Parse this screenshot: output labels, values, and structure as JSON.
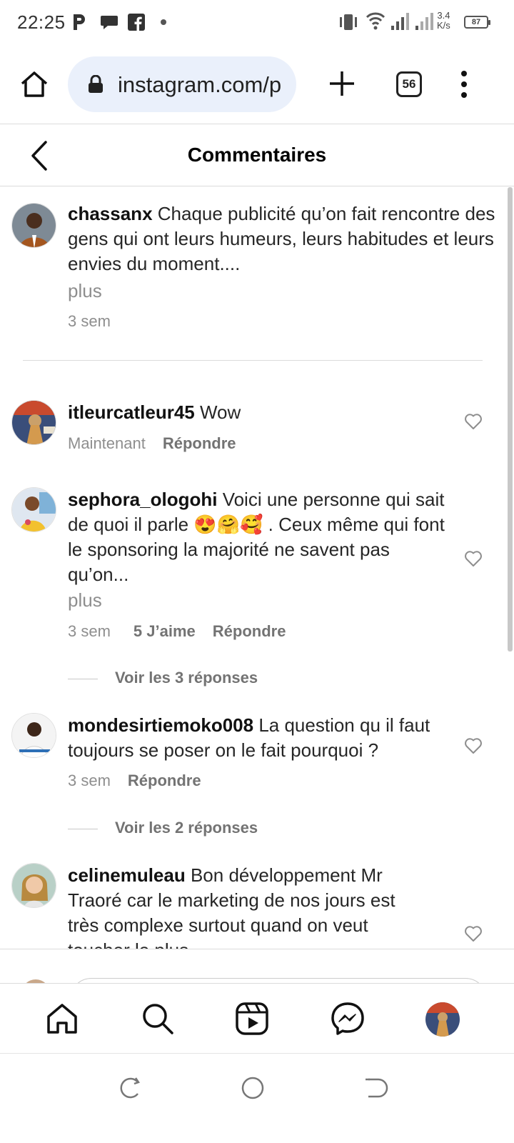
{
  "status_bar": {
    "time": "22:25",
    "notif_icons": [
      "p-icon",
      "chat-icon",
      "facebook-icon",
      "dot-icon"
    ],
    "speed_top": "3.4",
    "speed_bottom": "K/s",
    "battery": "87"
  },
  "browser": {
    "url": "instagram.com/p",
    "tab_count": "56"
  },
  "header": {
    "title": "Commentaires"
  },
  "comments": [
    {
      "user": "chassanx",
      "text": " Chaque publicité qu’on fait rencontre des gens qui ont leurs humeurs, leurs habitudes et leurs envies du moment....",
      "more": "plus",
      "time": "3 sem"
    },
    {
      "user": "itleurcatleur45",
      "text": " Wow",
      "time": "Maintenant",
      "reply": "Répondre"
    },
    {
      "user": "sephora_ologohi",
      "text": " Voici une personne qui sait de quoi il parle 😍🤗🥰 . Ceux même qui font le sponsoring la majorité ne savent pas qu’on...",
      "more": "plus",
      "time": "3 sem",
      "likes": "5 J’aime",
      "reply": "Répondre",
      "view_replies": "Voir les 3 réponses"
    },
    {
      "user": "mondesirtiemoko008",
      "text": " La question qu il faut toujours se poser on le fait pourquoi ?",
      "time": "3 sem",
      "reply": "Répondre",
      "view_replies": "Voir les 2 réponses"
    },
    {
      "user": "celinemuleau",
      "text": " Bon développement Mr Traoré car le marketing de nos jours est très complexe surtout quand on veut toucher le plus"
    }
  ],
  "colors": {
    "url_bg": "#eaf0fb",
    "secondary_text": "#8e8e8e",
    "divider": "#dbdbdb"
  }
}
